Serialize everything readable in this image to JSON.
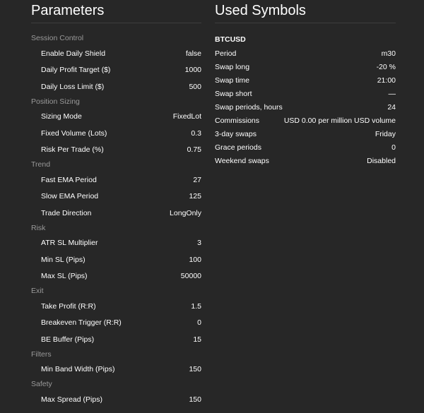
{
  "parameters": {
    "title": "Parameters",
    "groups": [
      {
        "label": "Session Control",
        "rows": [
          {
            "label": "Enable Daily Shield",
            "value": "false"
          },
          {
            "label": "Daily Profit Target ($)",
            "value": "1000"
          },
          {
            "label": "Daily Loss Limit ($)",
            "value": "500"
          }
        ]
      },
      {
        "label": "Position Sizing",
        "rows": [
          {
            "label": "Sizing Mode",
            "value": "FixedLot"
          },
          {
            "label": "Fixed Volume (Lots)",
            "value": "0.3"
          },
          {
            "label": "Risk Per Trade (%)",
            "value": "0.75"
          }
        ]
      },
      {
        "label": "Trend",
        "rows": [
          {
            "label": "Fast EMA Period",
            "value": "27"
          },
          {
            "label": "Slow EMA Period",
            "value": "125"
          },
          {
            "label": "Trade Direction",
            "value": "LongOnly"
          }
        ]
      },
      {
        "label": "Risk",
        "rows": [
          {
            "label": "ATR SL Multiplier",
            "value": "3"
          },
          {
            "label": "Min SL (Pips)",
            "value": "100"
          },
          {
            "label": "Max SL (Pips)",
            "value": "50000"
          }
        ]
      },
      {
        "label": "Exit",
        "rows": [
          {
            "label": "Take Profit (R:R)",
            "value": "1.5"
          },
          {
            "label": "Breakeven Trigger (R:R)",
            "value": "0"
          },
          {
            "label": "BE Buffer (Pips)",
            "value": "15"
          }
        ]
      },
      {
        "label": "Filters",
        "rows": [
          {
            "label": "Min Band Width (Pips)",
            "value": "150"
          }
        ]
      },
      {
        "label": "Safety",
        "rows": [
          {
            "label": "Max Spread (Pips)",
            "value": "150"
          }
        ]
      }
    ]
  },
  "symbols": {
    "title": "Used Symbols",
    "symbol": "BTCUSD",
    "rows": [
      {
        "label": "Period",
        "value": "m30"
      },
      {
        "label": "Swap long",
        "value": "-20 %"
      },
      {
        "label": "Swap time",
        "value": "21:00"
      },
      {
        "label": "Swap short",
        "value": "—"
      },
      {
        "label": "Swap periods, hours",
        "value": "24"
      },
      {
        "label": "Commissions",
        "value": "USD 0.00 per million USD volume"
      },
      {
        "label": "3-day swaps",
        "value": "Friday"
      },
      {
        "label": "Grace periods",
        "value": "0"
      },
      {
        "label": "Weekend swaps",
        "value": "Disabled"
      }
    ]
  }
}
